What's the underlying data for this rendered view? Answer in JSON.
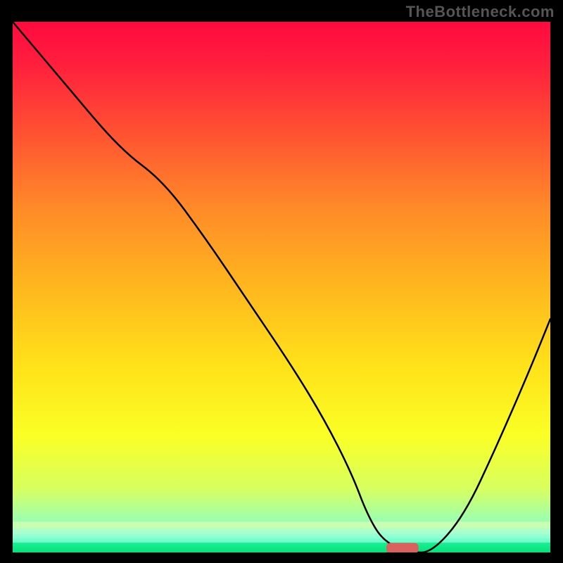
{
  "watermark": "TheBottleneck.com",
  "chart_data": {
    "type": "line",
    "title": "",
    "xlabel": "",
    "ylabel": "",
    "xlim": [
      0,
      100
    ],
    "ylim": [
      0,
      100
    ],
    "background_gradient": {
      "stops": [
        {
          "offset": 0.0,
          "color": "#ff0a3f"
        },
        {
          "offset": 0.08,
          "color": "#ff1f3d"
        },
        {
          "offset": 0.2,
          "color": "#ff4e33"
        },
        {
          "offset": 0.35,
          "color": "#ff8a28"
        },
        {
          "offset": 0.5,
          "color": "#ffb71e"
        },
        {
          "offset": 0.65,
          "color": "#ffe21a"
        },
        {
          "offset": 0.78,
          "color": "#faff25"
        },
        {
          "offset": 0.88,
          "color": "#d7ff60"
        },
        {
          "offset": 0.94,
          "color": "#9cffb0"
        },
        {
          "offset": 0.975,
          "color": "#5affc8"
        },
        {
          "offset": 1.0,
          "color": "#00e47a"
        }
      ]
    },
    "series": [
      {
        "name": "bottleneck-curve",
        "stroke": "#000000",
        "x": [
          0,
          10,
          20,
          28,
          36,
          44,
          52,
          58,
          63,
          66,
          69,
          74,
          78,
          84,
          90,
          96,
          100
        ],
        "y": [
          100,
          88,
          76,
          70,
          59,
          47,
          35,
          25,
          15,
          7,
          2,
          0,
          0,
          7,
          20,
          34,
          44
        ]
      }
    ],
    "marker": {
      "name": "optimal-marker",
      "shape": "rounded-rect",
      "color": "#d9625f",
      "x": 72.5,
      "y": 0.8,
      "width": 6,
      "height": 2
    }
  }
}
